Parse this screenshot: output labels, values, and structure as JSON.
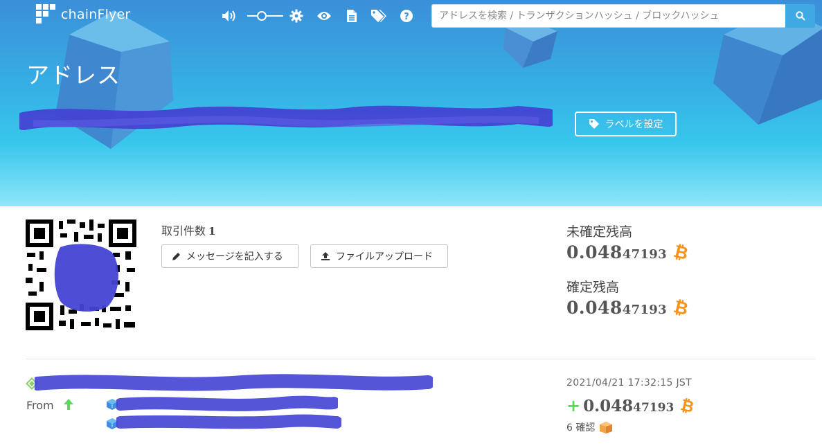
{
  "header": {
    "brand": "chainFlyer",
    "icons": [
      "volume-icon",
      "font-size-slider",
      "gear-icon",
      "eye-icon",
      "document-icon",
      "tags-icon",
      "help-icon"
    ],
    "search": {
      "placeholder": "アドレスを検索 / トランザクションハッシュ / ブロックハッシュ",
      "value": ""
    }
  },
  "hero": {
    "title": "アドレス",
    "label_button": "ラベルを設定"
  },
  "summary": {
    "tx_count_label": "取引件数",
    "tx_count": "1",
    "message_button": "メッセージを記入する",
    "upload_button": "ファイルアップロード",
    "unconfirmed_label": "未確定残高",
    "unconfirmed_big": "0.048",
    "unconfirmed_small": "47193",
    "confirmed_label": "確定残高",
    "confirmed_big": "0.048",
    "confirmed_small": "47193"
  },
  "transaction": {
    "from_label": "From",
    "timestamp": "2021/04/21 17:32:15 JST",
    "amount_sign": "+",
    "amount_big": "0.048",
    "amount_small": "47193",
    "confirmations": "6 確認"
  },
  "colors": {
    "hero_top": "#3b8fd8",
    "hero_bottom": "#8fe6f8",
    "bitcoin": "#f7931a",
    "positive": "#5cd65c",
    "redaction": "#4343d3"
  }
}
